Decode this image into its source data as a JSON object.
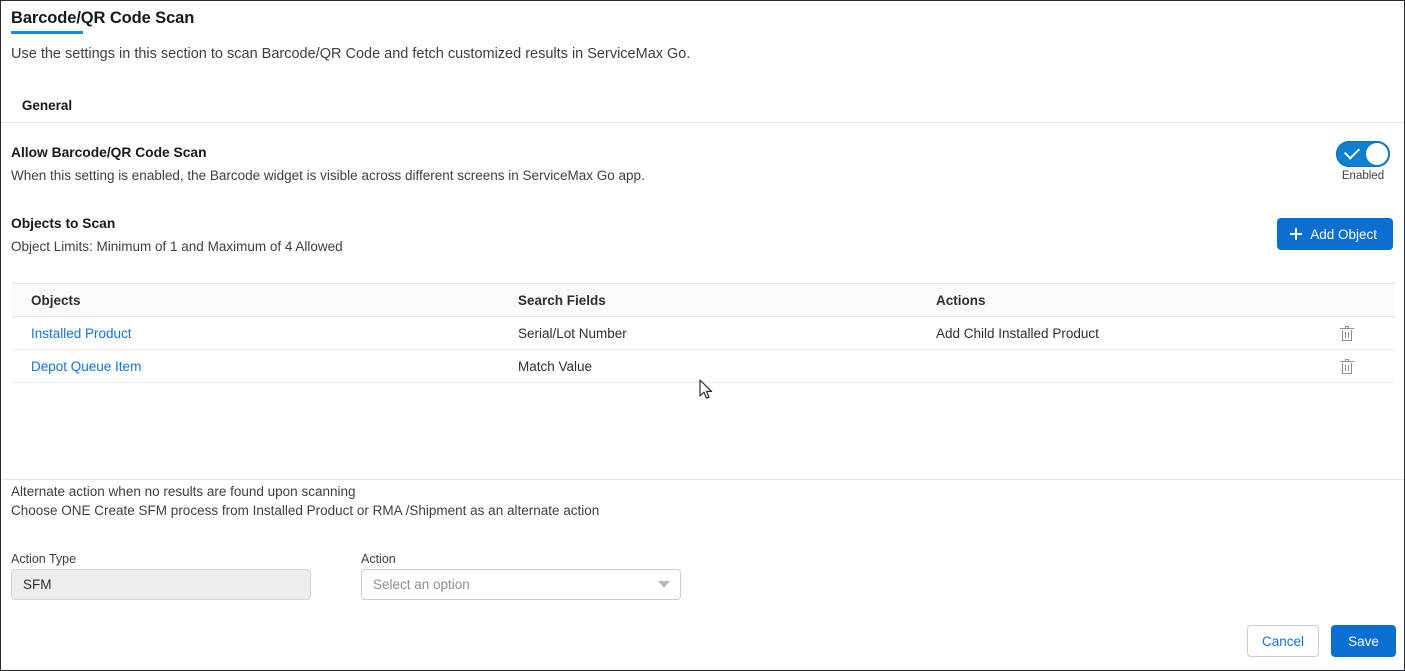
{
  "header": {
    "title": "Barcode/QR Code Scan",
    "subtitle": "Use the settings in this section to scan Barcode/QR Code and fetch customized results in ServiceMax Go."
  },
  "tabs": [
    {
      "label": "General",
      "active": true
    }
  ],
  "allow_setting": {
    "title": "Allow Barcode/QR Code Scan",
    "description": "When this setting is enabled, the Barcode widget is visible across different screens in ServiceMax Go app.",
    "toggle_state_label": "Enabled",
    "toggle_on": true,
    "accent_color": "#0f7fd4"
  },
  "objects_section": {
    "title": "Objects to Scan",
    "description": "Object Limits: Minimum of 1 and Maximum of 4 Allowed",
    "add_button_label": "Add Object"
  },
  "table": {
    "columns": [
      "Objects",
      "Search Fields",
      "Actions"
    ],
    "rows": [
      {
        "object": "Installed Product",
        "search_field": "Serial/Lot Number",
        "action": "Add Child Installed Product"
      },
      {
        "object": "Depot Queue Item",
        "search_field": "Match Value",
        "action": ""
      }
    ]
  },
  "alternate_action": {
    "line1": "Alternate action when no results are found upon scanning",
    "line2": "Choose ONE Create SFM process from Installed Product or RMA /Shipment as an alternate action",
    "action_type_label": "Action Type",
    "action_type_value": "SFM",
    "action_label": "Action",
    "action_placeholder": "Select an option"
  },
  "footer": {
    "cancel_label": "Cancel",
    "save_label": "Save",
    "primary_color": "#0b6fd1",
    "link_color": "#1273d8"
  }
}
